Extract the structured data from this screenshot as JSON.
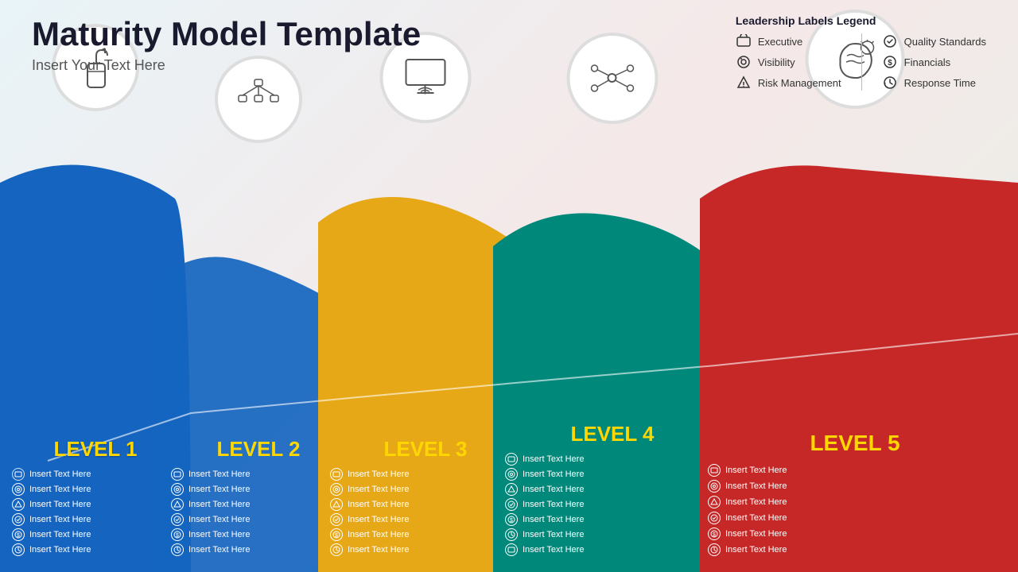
{
  "header": {
    "title": "Maturity Model Template",
    "subtitle": "Insert Your Text Here"
  },
  "legend": {
    "title": "Leadership Labels Legend",
    "col1": [
      {
        "icon": "🔲",
        "label": "Executive"
      },
      {
        "icon": "⚙",
        "label": "Visibility"
      },
      {
        "icon": "🔺",
        "label": "Risk Management"
      }
    ],
    "col2": [
      {
        "icon": "💡",
        "label": "Quality Standards"
      },
      {
        "icon": "💲",
        "label": "Financials"
      },
      {
        "icon": "🕐",
        "label": "Response Time"
      }
    ]
  },
  "levels": [
    {
      "id": 1,
      "label": "LEVEL 1",
      "color": "#1565c0",
      "items": [
        "Insert Text Here",
        "Insert Text Here",
        "Insert Text Here",
        "Insert Text Here",
        "Insert Text Here",
        "Insert Text Here"
      ]
    },
    {
      "id": 2,
      "label": "LEVEL 2",
      "color": "#1565c0",
      "items": [
        "Insert Text Here",
        "Insert Text Here",
        "Insert Text Here",
        "Insert Text Here",
        "Insert Text Here",
        "Insert Text Here"
      ]
    },
    {
      "id": 3,
      "label": "LEVEL 3",
      "color": "#e6a817",
      "items": [
        "Insert Text Here",
        "Insert Text Here",
        "Insert Text Here",
        "Insert Text Here",
        "Insert Text Here",
        "Insert Text Here"
      ]
    },
    {
      "id": 4,
      "label": "LEVEL 4",
      "color": "#00897b",
      "items": [
        "Insert Text Here",
        "Insert Text Here",
        "Insert Text Here",
        "Insert Text Here",
        "Insert Text Here",
        "Insert Text Here",
        "Insert Text Here"
      ]
    },
    {
      "id": 5,
      "label": "LEVEL 5",
      "color": "#c62828",
      "items": [
        "Insert Text Here",
        "Insert Text Here",
        "Insert Text Here",
        "Insert Text Here",
        "Insert Text Here",
        "Insert Text Here"
      ]
    }
  ]
}
